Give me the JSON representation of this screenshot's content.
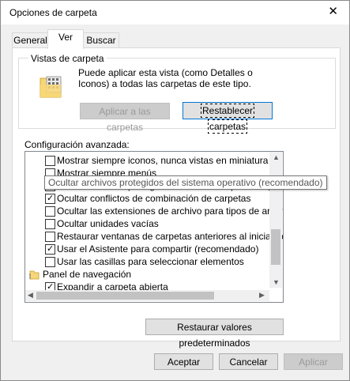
{
  "window": {
    "title": "Opciones de carpeta",
    "close_glyph": "✕"
  },
  "tabs": [
    {
      "label": "General"
    },
    {
      "label": "Ver"
    },
    {
      "label": "Buscar"
    }
  ],
  "vistas": {
    "group_title": "Vistas de carpeta",
    "description": "Puede aplicar esta vista (como Detalles o Iconos) a todas las carpetas de este tipo.",
    "apply_label": "Aplicar a las carpetas",
    "reset_label": "Restablecer carpetas"
  },
  "advanced": {
    "label": "Configuración avanzada:",
    "items": [
      {
        "label": "Mostrar siempre iconos, nunca vistas en miniatura",
        "checked": false
      },
      {
        "label": "Mostrar siempre menús",
        "checked": false
      },
      {
        "label": "Ocultar archivos protegidos del sistema operativo (recomendado)",
        "checked": false
      },
      {
        "label": "Ocultar conflictos de combinación de carpetas",
        "checked": true
      },
      {
        "label": "Ocultar las extensiones de archivo para tipos de archivo c",
        "checked": false
      },
      {
        "label": "Ocultar unidades vacías",
        "checked": false
      },
      {
        "label": "Restaurar ventanas de carpetas anteriores al iniciar sesió",
        "checked": false
      },
      {
        "label": "Usar el Asistente para compartir (recomendado)",
        "checked": true
      },
      {
        "label": "Usar las casillas para seleccionar elementos",
        "checked": false
      }
    ],
    "nav_group": "Panel de navegación",
    "nav_items": [
      {
        "label": "Expandir a carpeta abierta",
        "checked": true
      }
    ],
    "tooltip": "Ocultar archivos protegidos del sistema operativo (recomendado)"
  },
  "restore_defaults_label": "Restaurar valores predeterminados",
  "footer": {
    "ok": "Aceptar",
    "cancel": "Cancelar",
    "apply": "Aplicar"
  },
  "icons": {
    "close": "close-icon",
    "folder": "folder-options-icon",
    "nav": "navigation-pane-icon",
    "scroll_up": "▲",
    "scroll_down": "▼",
    "scroll_left": "◀",
    "scroll_right": "▶"
  }
}
